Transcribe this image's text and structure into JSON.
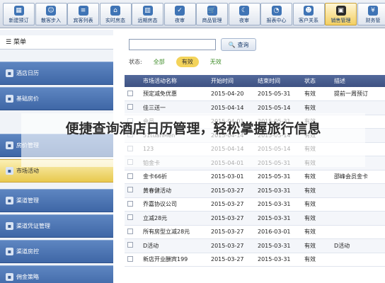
{
  "toolbar": {
    "buttons": [
      {
        "label": "新建预订",
        "icon": "calendar-icon"
      },
      {
        "label": "散客步入",
        "icon": "users-icon"
      },
      {
        "label": "宾客列表",
        "icon": "list-icon"
      },
      {
        "label": "实时房态",
        "icon": "home-icon"
      },
      {
        "label": "远期房态",
        "icon": "building-icon"
      },
      {
        "label": "夜审",
        "icon": "check-icon"
      },
      {
        "label": "商品管理",
        "icon": "cart-icon"
      },
      {
        "label": "夜审",
        "icon": "moon-icon"
      },
      {
        "label": "报表中心",
        "icon": "chart-icon"
      },
      {
        "label": "客户关系",
        "icon": "people-icon"
      },
      {
        "label": "销售管理",
        "icon": "bag-icon"
      },
      {
        "label": "财务管",
        "icon": "finance-icon"
      }
    ]
  },
  "sidebar": {
    "title": "菜单",
    "items": [
      {
        "label": "酒店日历"
      },
      {
        "label": "基础房价"
      },
      {
        "label": "房价管理"
      },
      {
        "label": "市场活动"
      },
      {
        "label": "渠道管理"
      },
      {
        "label": "渠道凭证管理"
      },
      {
        "label": "渠道房控"
      },
      {
        "label": "佣金策略"
      }
    ],
    "active_index": 3
  },
  "search": {
    "placeholder": "",
    "button_label": "查询"
  },
  "status_filter": {
    "label": "状态:",
    "options": [
      "全部",
      "有效",
      "无效"
    ],
    "selected": "有效"
  },
  "table": {
    "headers": [
      "",
      "市场活动名称",
      "开始时间",
      "结束时间",
      "状态",
      "描述"
    ],
    "rows": [
      [
        "预定减免优惠",
        "2015-04-20",
        "2015-05-31",
        "有效",
        "提前一周预订"
      ],
      [
        "佳三送一",
        "2015-04-14",
        "2015-05-14",
        "有效",
        ""
      ],
      [
        "会员",
        "2015-04-01",
        "2015-05-31",
        "有效",
        ""
      ],
      [
        "51tuanMen",
        "2015-04-14",
        "2015-05-14",
        "有效",
        ""
      ],
      [
        "123",
        "2015-04-14",
        "2015-05-14",
        "有效",
        ""
      ],
      [
        "铂金卡",
        "2015-04-01",
        "2015-05-31",
        "有效",
        ""
      ],
      [
        "金卡66折",
        "2015-03-01",
        "2015-05-31",
        "有效",
        "邵峰会员金卡"
      ],
      [
        "黄春健活动",
        "2015-03-27",
        "2015-03-31",
        "有效",
        ""
      ],
      [
        "乔嘉协议公司",
        "2015-03-27",
        "2015-03-31",
        "有效",
        ""
      ],
      [
        "立减28元",
        "2015-03-27",
        "2015-03-31",
        "有效",
        ""
      ],
      [
        "所有房型立减28元",
        "2015-03-27",
        "2016-03-01",
        "有效",
        ""
      ],
      [
        "D活动",
        "2015-03-27",
        "2015-03-31",
        "有效",
        "D活动"
      ],
      [
        "新店开业酬宾199",
        "2015-03-27",
        "2015-03-31",
        "有效",
        ""
      ]
    ]
  },
  "banner": {
    "text": "便捷查询酒店日历管理，轻松掌握旅行信息"
  }
}
